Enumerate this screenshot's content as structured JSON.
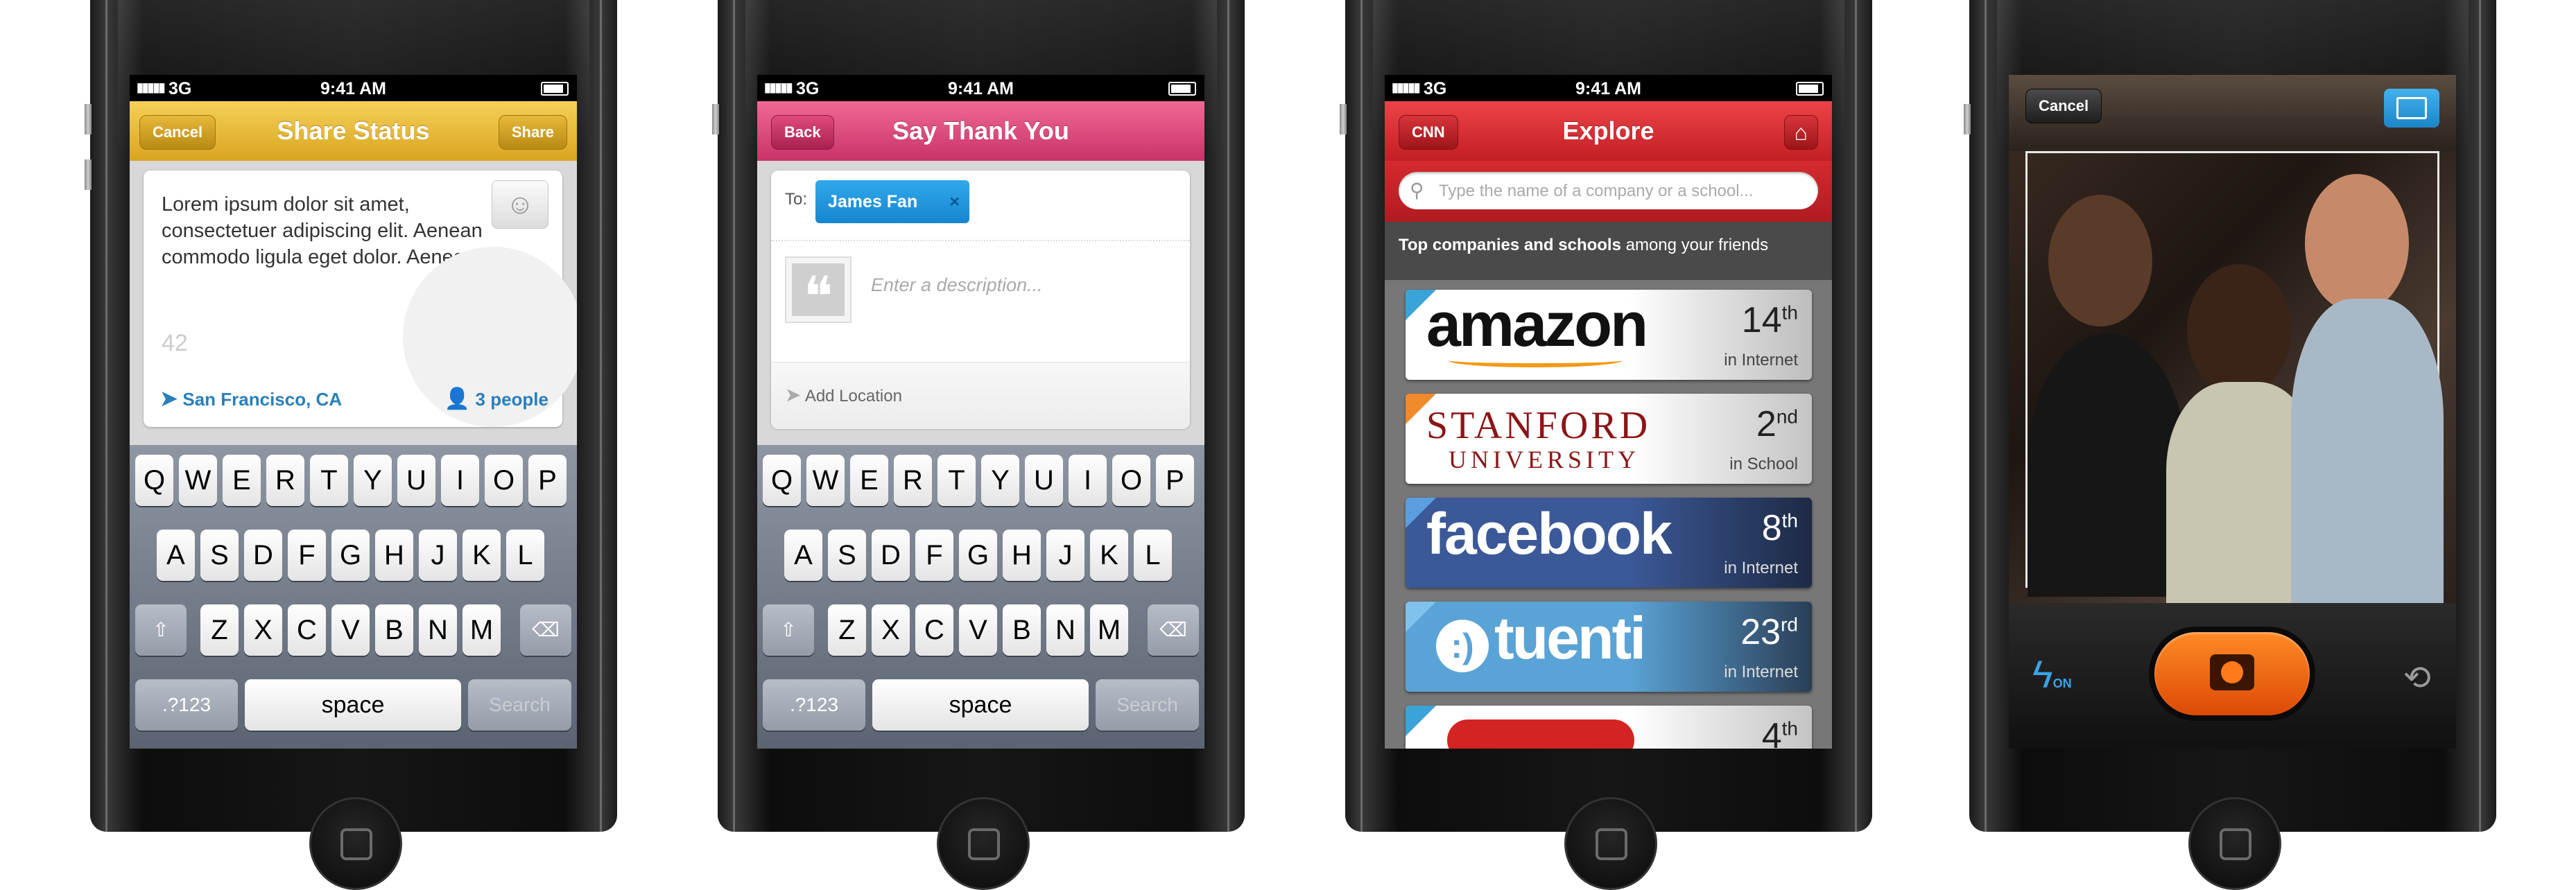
{
  "status": {
    "carrier": "3G",
    "time": "9:41 AM"
  },
  "screen1": {
    "title": "Share Status",
    "cancel": "Cancel",
    "share": "Share",
    "text": "Lorem ipsum dolor sit amet, consectetuer adipiscing elit. Aenean commodo ligula eget dolor. Aenean",
    "char_count": "42",
    "location": "San Francisco, CA",
    "people": "3 people",
    "color": "#e8b830"
  },
  "screen2": {
    "title": "Say Thank You",
    "back": "Back",
    "to_label": "To:",
    "recipient": "James Fan",
    "remove": "×",
    "description_placeholder": "Enter a description...",
    "add_location": "Add Location",
    "color": "#e0457a"
  },
  "keyboard": {
    "row1": [
      "Q",
      "W",
      "E",
      "R",
      "T",
      "Y",
      "U",
      "I",
      "O",
      "P"
    ],
    "row2": [
      "A",
      "S",
      "D",
      "F",
      "G",
      "H",
      "J",
      "K",
      "L"
    ],
    "row3": [
      "Z",
      "X",
      "C",
      "V",
      "B",
      "N",
      "M"
    ],
    "shift": "⇧",
    "delete": "⌫",
    "numbers": ".?123",
    "space": "space",
    "search": "Search"
  },
  "screen3": {
    "title": "Explore",
    "back": "CNN",
    "home": "⌂",
    "search_placeholder": "Type the name of a company or a school...",
    "heading_bold": "Top companies and schools",
    "heading_rest": " among your friends",
    "color": "#d72a2f",
    "items": [
      {
        "name": "amazon",
        "rank": "14",
        "suffix": "th",
        "category": "in Internet"
      },
      {
        "name": "STANFORD",
        "name2": "UNIVERSITY",
        "rank": "2",
        "suffix": "nd",
        "category": "in School"
      },
      {
        "name": "facebook",
        "rank": "8",
        "suffix": "th",
        "category": "in Internet"
      },
      {
        "name": "tuenti",
        "rank": "23",
        "suffix": "rd",
        "category": "in Internet"
      },
      {
        "name": "",
        "rank": "4",
        "suffix": "th",
        "category": ""
      }
    ]
  },
  "screen4": {
    "cancel": "Cancel",
    "flash_label": "ON"
  }
}
